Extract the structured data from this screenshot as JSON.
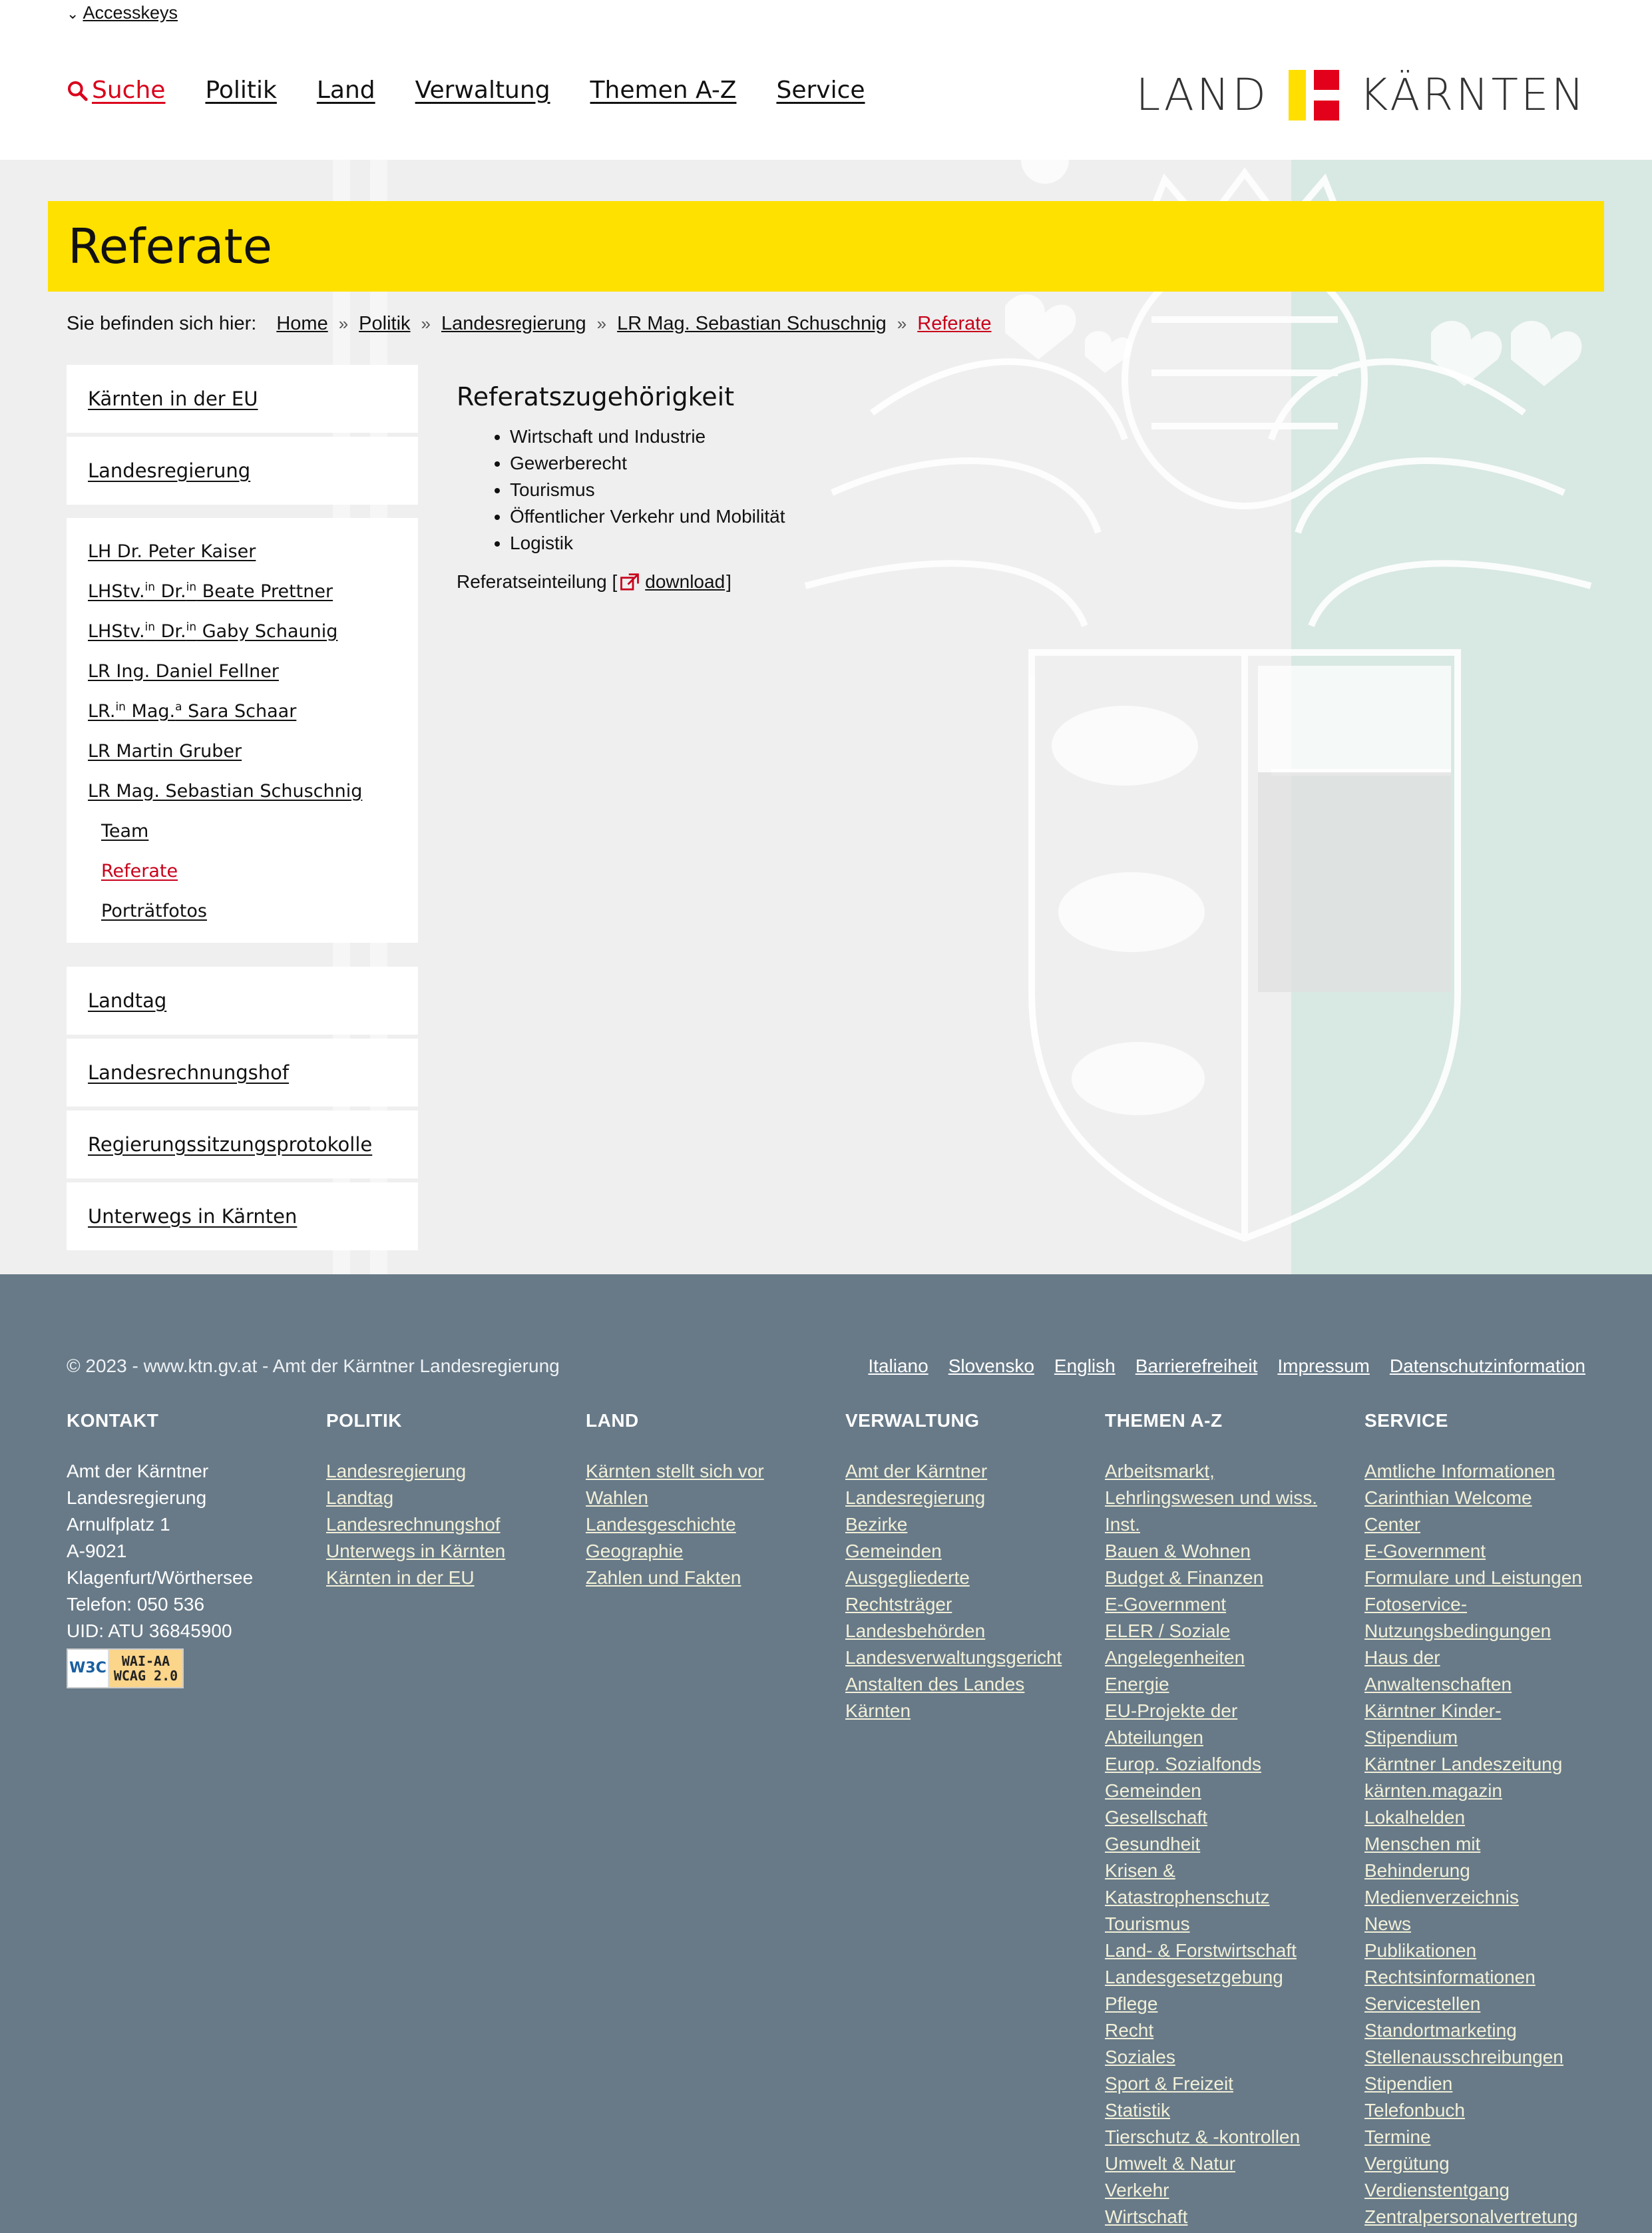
{
  "header": {
    "accesskeys": "Accesskeys",
    "nav": [
      {
        "label": "Suche",
        "icon": "search-icon"
      },
      {
        "label": "Politik"
      },
      {
        "label": "Land"
      },
      {
        "label": "Verwaltung"
      },
      {
        "label": "Themen A-Z"
      },
      {
        "label": "Service"
      }
    ],
    "logo_left": "LAND",
    "logo_right": "KÄRNTEN"
  },
  "page": {
    "title": "Referate",
    "breadcrumb_lead": "Sie befinden sich hier:",
    "breadcrumb": [
      "Home",
      "Politik",
      "Landesregierung",
      "LR Mag. Sebastian Schuschnig",
      "Referate"
    ]
  },
  "sidebar": {
    "top": [
      "Kärnten in der EU",
      "Landesregierung"
    ],
    "sub": {
      "kaiser": "LH Dr. Peter Kaiser",
      "prettner": {
        "a": "LHStv.",
        "a_sup": "in",
        "b": " Dr.",
        "b_sup": "in",
        "c": " Beate Prettner"
      },
      "schaunig": {
        "a": "LHStv.",
        "a_sup": "in",
        "b": " Dr.",
        "b_sup": "in",
        "c": " Gaby Schaunig"
      },
      "fellner": "LR Ing. Daniel Fellner",
      "schaar": {
        "a": "LR.",
        "a_sup": "in",
        "b": " Mag.",
        "b_sup": "a",
        "c": " Sara Schaar"
      },
      "gruber": "LR Martin Gruber",
      "schuschnig": "LR Mag. Sebastian Schuschnig",
      "team": "Team",
      "referate": "Referate",
      "portraits": "Porträtfotos"
    },
    "bottom": [
      "Landtag",
      "Landesrechnungshof",
      "Regierungssitzungsprotokolle",
      "Unterwegs in Kärnten"
    ]
  },
  "content": {
    "heading": "Referatszugehörigkeit",
    "items": [
      "Wirtschaft und Industrie",
      "Gewerberecht",
      "Tourismus",
      "Öffentlicher Verkehr und Mobilität",
      "Logistik"
    ],
    "download_prefix": "Referatseinteilung [",
    "download_label": "download",
    "download_suffix": "]"
  },
  "footer": {
    "copyright": "© 2023 - www.ktn.gv.at - Amt der Kärntner Landesregierung",
    "links": [
      "Italiano",
      "Slovensko",
      "English",
      "Barrierefreiheit",
      "Impressum",
      "Datenschutzinformation"
    ],
    "kontakt": {
      "title": "KONTAKT",
      "lines": [
        "Amt der Kärntner",
        "Landesregierung",
        "Arnulfplatz 1",
        "A-9021",
        "Klagenfurt/Wörthersee",
        "Telefon: 050 536",
        "UID: ATU 36845900"
      ],
      "badge_w3c": "W3C",
      "badge_l1": "WAI-AA",
      "badge_l2": "WCAG 2.0"
    },
    "politik": {
      "title": "POLITIK",
      "links": [
        "Landesregierung",
        "Landtag",
        "Landesrechnungshof",
        "Unterwegs in Kärnten",
        "Kärnten in der EU"
      ]
    },
    "land": {
      "title": "LAND",
      "links": [
        "Kärnten stellt sich vor",
        "Wahlen",
        "Landesgeschichte",
        "Geographie",
        "Zahlen und Fakten"
      ]
    },
    "verwaltung": {
      "title": "VERWALTUNG",
      "links": [
        "Amt der Kärntner Landesregierung",
        "Bezirke",
        "Gemeinden",
        "Ausgegliederte Rechtsträger",
        "Landesbehörden",
        "Landesverwaltungsgericht",
        "Anstalten des Landes Kärnten"
      ]
    },
    "themen": {
      "title": "THEMEN A-Z",
      "links": [
        "Arbeitsmarkt, Lehrlingswesen und wiss. Inst.",
        "Bauen & Wohnen",
        "Budget & Finanzen",
        "E-Government",
        "ELER / Soziale Angelegenheiten",
        "Energie",
        "EU-Projekte der Abteilungen",
        "Europ. Sozialfonds",
        "Gemeinden",
        "Gesellschaft",
        "Gesundheit",
        "Krisen & Katastrophenschutz",
        "Tourismus",
        "Land- & Forstwirtschaft",
        "Landesgesetzgebung",
        "Pflege",
        "Recht",
        "Soziales",
        "Sport & Freizeit",
        "Statistik",
        "Tierschutz & -kontrollen",
        "Umwelt & Natur",
        "Verkehr",
        "Wirtschaft"
      ]
    },
    "service": {
      "title": "SERVICE",
      "links": [
        "Amtliche Informationen",
        "Carinthian Welcome Center",
        "E-Government",
        "Formulare und Leistungen",
        "Fotoservice-Nutzungsbedingungen",
        "Haus der Anwaltenschaften",
        "Kärntner Kinder-Stipendium",
        "Kärntner Landeszeitung",
        "kärnten.magazin",
        "Lokalhelden",
        "Menschen mit Behinderung",
        "Medienverzeichnis",
        "News",
        "Publikationen",
        "Rechtsinformationen",
        "Servicestellen",
        "Standortmarketing",
        "Stellenausschreibungen",
        "Stipendien",
        "Telefonbuch",
        "Termine",
        "Vergütung",
        "Verdienstentgang",
        "Zentralpersonalvertretung"
      ]
    }
  },
  "colors": {
    "accent_red": "#c8001a",
    "title_yellow": "#ffe100",
    "footer_bg": "#687a88",
    "footer_link": "#f2f0d8"
  }
}
